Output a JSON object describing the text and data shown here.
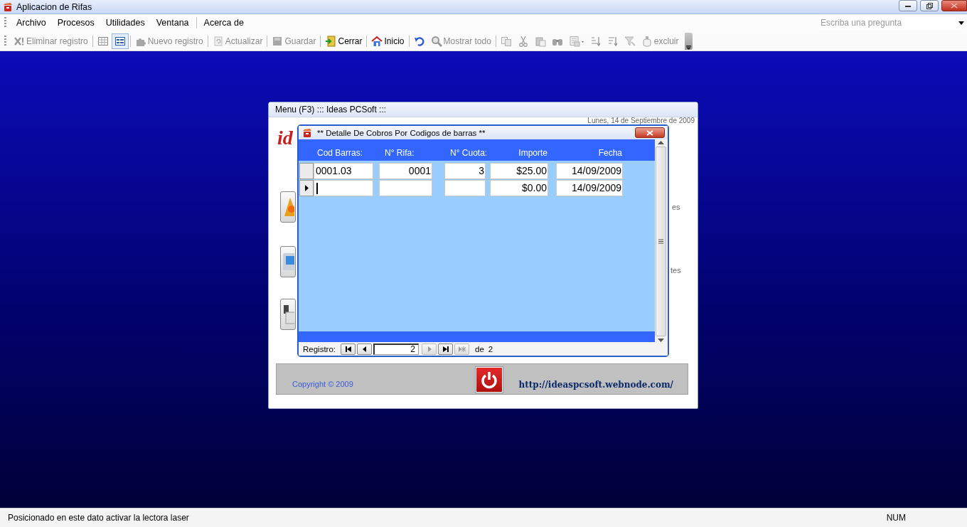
{
  "window": {
    "title": "Aplicacion de Rifas"
  },
  "menu": [
    {
      "label": "Archivo"
    },
    {
      "label": "Procesos"
    },
    {
      "label": "Utilidades"
    },
    {
      "label": "Ventana"
    },
    {
      "label": "Acerca de"
    }
  ],
  "ask_box": {
    "placeholder": "Escriba una pregunta"
  },
  "toolbar": [
    {
      "kind": "button",
      "label": "Eliminar registro",
      "disabled": true
    },
    {
      "kind": "separator"
    },
    {
      "kind": "icon",
      "disabled": false,
      "selected": false
    },
    {
      "kind": "icon",
      "disabled": false,
      "selected": true
    },
    {
      "kind": "separator"
    },
    {
      "kind": "button",
      "label": "Nuevo registro",
      "disabled": true
    },
    {
      "kind": "separator"
    },
    {
      "kind": "button",
      "label": "Actualizar",
      "disabled": true
    },
    {
      "kind": "separator"
    },
    {
      "kind": "button",
      "label": "Guardar",
      "disabled": true
    },
    {
      "kind": "separator"
    },
    {
      "kind": "button",
      "label": "Cerrar",
      "disabled": false
    },
    {
      "kind": "separator"
    },
    {
      "kind": "button",
      "label": "Inicio",
      "disabled": false
    },
    {
      "kind": "separator"
    },
    {
      "kind": "icon",
      "disabled": false
    },
    {
      "kind": "button",
      "label": "Mostrar todo",
      "disabled": true
    },
    {
      "kind": "separator"
    },
    {
      "kind": "icon",
      "disabled": true
    },
    {
      "kind": "icon",
      "disabled": true
    },
    {
      "kind": "icon",
      "disabled": true
    },
    {
      "kind": "icon",
      "disabled": true
    },
    {
      "kind": "dropdown",
      "disabled": true
    },
    {
      "kind": "icon",
      "disabled": true
    },
    {
      "kind": "icon",
      "disabled": true
    },
    {
      "kind": "icon",
      "disabled": true
    },
    {
      "kind": "button",
      "label": "excluir",
      "disabled": true
    }
  ],
  "menu_window": {
    "title": "Menu (F3) ::: Ideas PCSoft :::",
    "date": "Lunes, 14 de Septiembre de 2009",
    "logo": "id",
    "side_labels": [
      "es",
      "tes"
    ],
    "footer": {
      "copyright": "Copyright © 2009",
      "url": "http://ideaspcsoft.webnode.com/"
    }
  },
  "dialog": {
    "title": "** Detalle De Cobros Por Codigos de barras **",
    "columns": [
      "Cod Barras:",
      "N° Rifa:",
      "N° Cuota:",
      "Importe",
      "Fecha"
    ],
    "rows": [
      {
        "current": false,
        "cells": [
          "0001.03",
          "0001",
          "3",
          "$25.00",
          "14/09/2009"
        ]
      },
      {
        "current": true,
        "cells": [
          null,
          null,
          null,
          "$0.00",
          "14/09/2009"
        ]
      }
    ],
    "navigator": {
      "label": "Registro:",
      "value": "2",
      "of_label": "de",
      "total": "2"
    }
  },
  "status_bar": {
    "message": "Posicionado en este dato activar la lectora laser",
    "indicator": "NUM"
  }
}
